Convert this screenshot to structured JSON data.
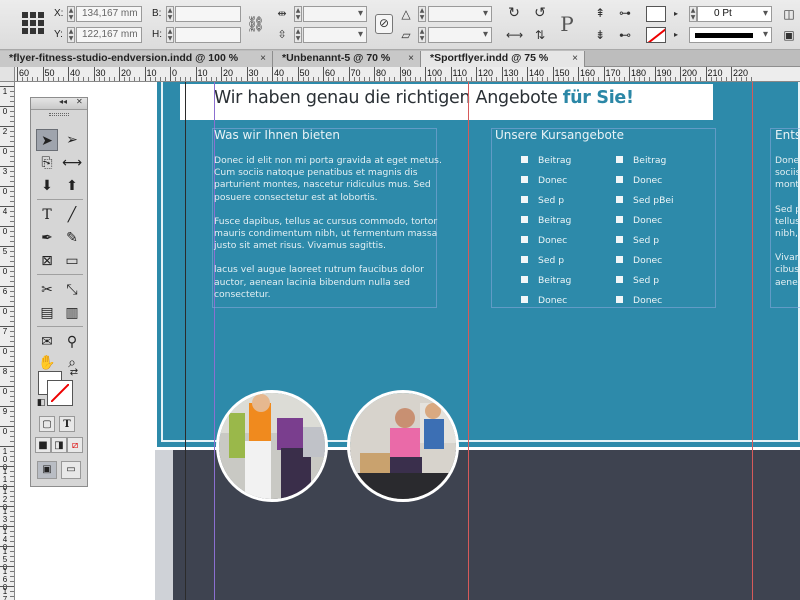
{
  "control_bar": {
    "x_label": "X:",
    "y_label": "Y:",
    "x_value": "134,167 mm",
    "y_value": "122,167 mm",
    "w_label": "B:",
    "h_label": "H:",
    "stroke_weight": "0 Pt",
    "proxy_letter": "P"
  },
  "tabs": [
    {
      "label": "*flyer-fitness-studio-endversion.indd @ 100 %",
      "close": "×"
    },
    {
      "label": "*Unbenannt-5 @ 70 %",
      "close": "×"
    },
    {
      "label": "*Sportflyer.indd @ 75 %",
      "close": "×"
    }
  ],
  "ruler": {
    "h_labels": [
      "60",
      "50",
      "40",
      "30",
      "20",
      "10",
      "0",
      "10",
      "20",
      "30",
      "40",
      "50",
      "60",
      "70",
      "80",
      "90",
      "100",
      "110",
      "120",
      "130",
      "140",
      "150",
      "160",
      "170",
      "180",
      "190",
      "200",
      "210",
      "220"
    ],
    "v_labels": [
      "1",
      "0",
      "2",
      "0",
      "3",
      "0",
      "4",
      "0",
      "5",
      "0",
      "6",
      "0",
      "7",
      "0",
      "8",
      "0",
      "9",
      "0",
      "1 0 0",
      "1 1 0",
      "1 2 0",
      "1 3 0",
      "1 4 0",
      "1 5 0",
      "1 6 0",
      "1 7 0"
    ]
  },
  "document": {
    "headline_main": "Wir haben genau die richtigen Angebote ",
    "headline_highlight": "für Sie!",
    "accent_color": "#2b87a6",
    "band_color": "#2d8aaa",
    "dark_color": "#3e4350",
    "col1": {
      "heading": "Was wir Ihnen bieten",
      "paragraphs": [
        "Donec id elit non mi porta gravida at eget metus. Cum sociis natoque penatibus et magnis dis parturient montes, nascetur ridiculus mus. Sed posuere consectetur est at lobortis.",
        "Fusce dapibus, tellus ac cursus commodo, tortor mauris condimentum nibh, ut fermentum massa justo sit amet risus. Vivamus sagittis.",
        "lacus vel augue laoreet rutrum faucibus dolor auctor, aenean lacinia bibendum nulla sed consectetur."
      ]
    },
    "col2": {
      "heading": "Unsere Kursangebote",
      "list_a": [
        "Beitrag",
        "Donec",
        "Sed p",
        "Beitrag",
        "Donec",
        "Sed p",
        "Beitrag",
        "Donec"
      ],
      "list_b": [
        "Beitrag",
        "Donec",
        "Sed pBei",
        "Donec",
        "Sed p",
        "Donec",
        "Sed p",
        "Donec"
      ]
    },
    "col3": {
      "heading": "Ents",
      "lines": [
        "Donec",
        "sociis",
        "monte",
        "",
        "Sed p",
        "tellus",
        "nibh, v",
        "",
        "Vivam",
        "cibus",
        "aenea"
      ]
    }
  },
  "tools": {
    "type_label": "T"
  }
}
